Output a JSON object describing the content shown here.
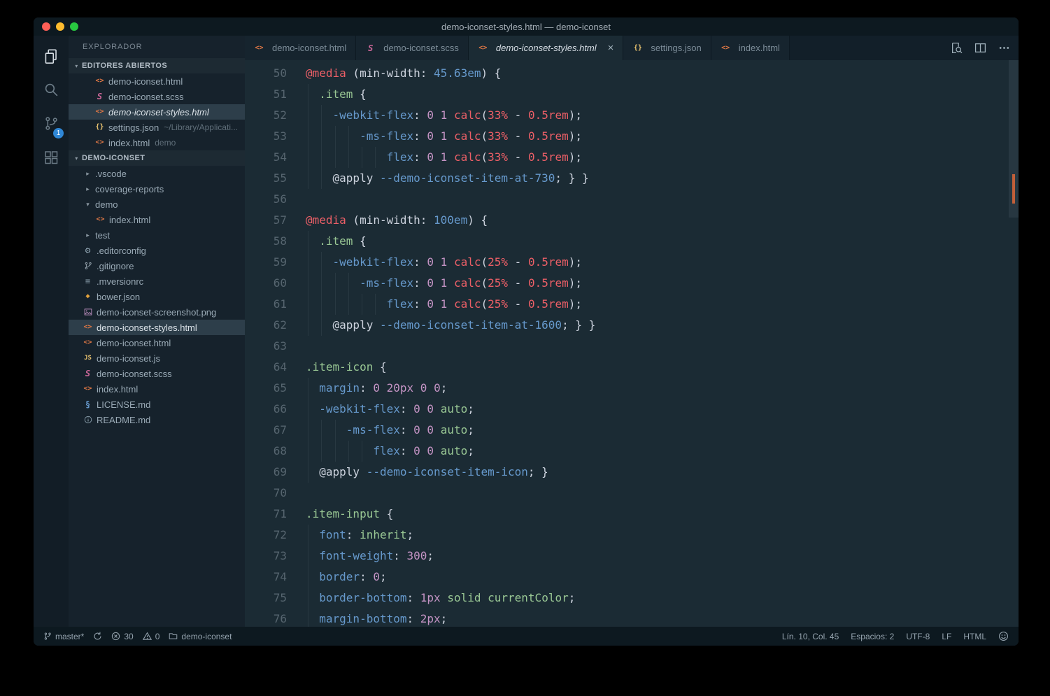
{
  "palette": {
    "editor_bg": "#1b2b34",
    "sidebar_bg": "#16222c",
    "titlebar_bg": "#0d1920",
    "activitybar_bg": "#121d26",
    "statusbar_bg": "#0d1920",
    "selection_bg": "#2d3e4a",
    "token_red": "#ec5f67",
    "token_blue": "#6699cc",
    "token_green": "#99c794",
    "token_purple": "#c594c5",
    "token_fg": "#cdd3de",
    "badge_blue": "#2f87d6",
    "overview_marker": "#c15f39"
  },
  "titlebar": {
    "title": "demo-iconset-styles.html — demo-iconset"
  },
  "activity_bar": {
    "items": [
      {
        "name": "explorer",
        "icon": "files-icon",
        "active": true
      },
      {
        "name": "search",
        "icon": "search-icon"
      },
      {
        "name": "source-control",
        "icon": "source-control-icon",
        "badge": "1"
      },
      {
        "name": "extensions",
        "icon": "extensions-icon"
      }
    ]
  },
  "sidebar": {
    "title": "EXPLORADOR",
    "sections": [
      {
        "label": "EDITORES ABIERTOS",
        "items": [
          {
            "icon": "html-icon",
            "label": "demo-iconset.html"
          },
          {
            "icon": "sass-icon",
            "label": "demo-iconset.scss"
          },
          {
            "icon": "html-icon",
            "label": "demo-iconset-styles.html",
            "active": true,
            "italic": true
          },
          {
            "icon": "json-icon",
            "label": "settings.json",
            "detail": "~/Library/Applicati..."
          },
          {
            "icon": "html-icon",
            "label": "index.html",
            "detail": "demo"
          }
        ]
      },
      {
        "label": "DEMO-ICONSET",
        "items": [
          {
            "chevron": "collapsed",
            "label": ".vscode"
          },
          {
            "chevron": "collapsed",
            "label": "coverage-reports"
          },
          {
            "chevron": "expanded",
            "label": "demo"
          },
          {
            "icon": "html-icon",
            "label": "index.html",
            "indent": 1
          },
          {
            "chevron": "collapsed",
            "label": "test"
          },
          {
            "icon": "gear-icon",
            "label": ".editorconfig"
          },
          {
            "icon": "git-icon",
            "label": ".gitignore"
          },
          {
            "icon": "list-icon",
            "label": ".mversionrc"
          },
          {
            "icon": "bower-icon",
            "label": "bower.json"
          },
          {
            "icon": "image-icon",
            "label": "demo-iconset-screenshot.png"
          },
          {
            "icon": "html-icon",
            "label": "demo-iconset-styles.html",
            "selected": true
          },
          {
            "icon": "html-icon",
            "label": "demo-iconset.html"
          },
          {
            "icon": "js-icon",
            "label": "demo-iconset.js"
          },
          {
            "icon": "sass-icon",
            "label": "demo-iconset.scss"
          },
          {
            "icon": "html-icon",
            "label": "index.html"
          },
          {
            "icon": "license-icon",
            "label": "LICENSE.md"
          },
          {
            "icon": "info-icon",
            "label": "README.md"
          }
        ]
      }
    ]
  },
  "tabs": [
    {
      "icon": "html-icon",
      "label": "demo-iconset.html"
    },
    {
      "icon": "sass-icon",
      "label": "demo-iconset.scss"
    },
    {
      "icon": "html-icon",
      "label": "demo-iconset-styles.html",
      "active": true,
      "close": "×"
    },
    {
      "icon": "json-icon",
      "label": "settings.json"
    },
    {
      "icon": "html-icon",
      "label": "index.html"
    }
  ],
  "editor_actions": [
    {
      "name": "open-preview-icon"
    },
    {
      "name": "split-editor-icon"
    },
    {
      "name": "more-actions-icon"
    }
  ],
  "editor": {
    "lines": [
      {
        "n": 50,
        "i": 0,
        "t": [
          [
            "@media",
            "r"
          ],
          [
            " (min-width: ",
            "f"
          ],
          [
            "45.63em",
            "b"
          ],
          [
            ") {",
            "f"
          ]
        ]
      },
      {
        "n": 51,
        "i": 2,
        "t": [
          [
            ".item",
            "g"
          ],
          [
            " {",
            "f"
          ]
        ]
      },
      {
        "n": 52,
        "i": 4,
        "t": [
          [
            "-webkit-flex",
            "b"
          ],
          [
            ": ",
            "f"
          ],
          [
            "0",
            "p"
          ],
          [
            " ",
            "f"
          ],
          [
            "1",
            "p"
          ],
          [
            " ",
            "f"
          ],
          [
            "calc",
            "r"
          ],
          [
            "(",
            "f"
          ],
          [
            "33%",
            "r"
          ],
          [
            " - ",
            "f"
          ],
          [
            "0.5rem",
            "r"
          ],
          [
            ");",
            "f"
          ]
        ]
      },
      {
        "n": 53,
        "i": 8,
        "t": [
          [
            "-ms-flex",
            "b"
          ],
          [
            ": ",
            "f"
          ],
          [
            "0",
            "p"
          ],
          [
            " ",
            "f"
          ],
          [
            "1",
            "p"
          ],
          [
            " ",
            "f"
          ],
          [
            "calc",
            "r"
          ],
          [
            "(",
            "f"
          ],
          [
            "33%",
            "r"
          ],
          [
            " - ",
            "f"
          ],
          [
            "0.5rem",
            "r"
          ],
          [
            ");",
            "f"
          ]
        ]
      },
      {
        "n": 54,
        "i": 12,
        "t": [
          [
            "flex",
            "b"
          ],
          [
            ": ",
            "f"
          ],
          [
            "0",
            "p"
          ],
          [
            " ",
            "f"
          ],
          [
            "1",
            "p"
          ],
          [
            " ",
            "f"
          ],
          [
            "calc",
            "r"
          ],
          [
            "(",
            "f"
          ],
          [
            "33%",
            "r"
          ],
          [
            " - ",
            "f"
          ],
          [
            "0.5rem",
            "r"
          ],
          [
            ");",
            "f"
          ]
        ]
      },
      {
        "n": 55,
        "i": 4,
        "t": [
          [
            "@apply ",
            "f"
          ],
          [
            "--demo-iconset-item-at-730",
            "b"
          ],
          [
            "; } }",
            "f"
          ]
        ]
      },
      {
        "n": 56,
        "i": 0,
        "t": []
      },
      {
        "n": 57,
        "i": 0,
        "t": [
          [
            "@media",
            "r"
          ],
          [
            " (min-width: ",
            "f"
          ],
          [
            "100em",
            "b"
          ],
          [
            ") {",
            "f"
          ]
        ]
      },
      {
        "n": 58,
        "i": 2,
        "t": [
          [
            ".item",
            "g"
          ],
          [
            " {",
            "f"
          ]
        ]
      },
      {
        "n": 59,
        "i": 4,
        "t": [
          [
            "-webkit-flex",
            "b"
          ],
          [
            ": ",
            "f"
          ],
          [
            "0",
            "p"
          ],
          [
            " ",
            "f"
          ],
          [
            "1",
            "p"
          ],
          [
            " ",
            "f"
          ],
          [
            "calc",
            "r"
          ],
          [
            "(",
            "f"
          ],
          [
            "25%",
            "r"
          ],
          [
            " - ",
            "f"
          ],
          [
            "0.5rem",
            "r"
          ],
          [
            ");",
            "f"
          ]
        ]
      },
      {
        "n": 60,
        "i": 8,
        "t": [
          [
            "-ms-flex",
            "b"
          ],
          [
            ": ",
            "f"
          ],
          [
            "0",
            "p"
          ],
          [
            " ",
            "f"
          ],
          [
            "1",
            "p"
          ],
          [
            " ",
            "f"
          ],
          [
            "calc",
            "r"
          ],
          [
            "(",
            "f"
          ],
          [
            "25%",
            "r"
          ],
          [
            " - ",
            "f"
          ],
          [
            "0.5rem",
            "r"
          ],
          [
            ");",
            "f"
          ]
        ]
      },
      {
        "n": 61,
        "i": 12,
        "t": [
          [
            "flex",
            "b"
          ],
          [
            ": ",
            "f"
          ],
          [
            "0",
            "p"
          ],
          [
            " ",
            "f"
          ],
          [
            "1",
            "p"
          ],
          [
            " ",
            "f"
          ],
          [
            "calc",
            "r"
          ],
          [
            "(",
            "f"
          ],
          [
            "25%",
            "r"
          ],
          [
            " - ",
            "f"
          ],
          [
            "0.5rem",
            "r"
          ],
          [
            ");",
            "f"
          ]
        ]
      },
      {
        "n": 62,
        "i": 4,
        "t": [
          [
            "@apply ",
            "f"
          ],
          [
            "--demo-iconset-item-at-1600",
            "b"
          ],
          [
            "; } }",
            "f"
          ]
        ]
      },
      {
        "n": 63,
        "i": 0,
        "t": []
      },
      {
        "n": 64,
        "i": 0,
        "t": [
          [
            ".item-icon",
            "g"
          ],
          [
            " {",
            "f"
          ]
        ]
      },
      {
        "n": 65,
        "i": 2,
        "t": [
          [
            "margin",
            "b"
          ],
          [
            ": ",
            "f"
          ],
          [
            "0",
            "p"
          ],
          [
            " ",
            "f"
          ],
          [
            "20px",
            "p"
          ],
          [
            " ",
            "f"
          ],
          [
            "0",
            "p"
          ],
          [
            " ",
            "f"
          ],
          [
            "0",
            "p"
          ],
          [
            ";",
            "f"
          ]
        ]
      },
      {
        "n": 66,
        "i": 2,
        "t": [
          [
            "-webkit-flex",
            "b"
          ],
          [
            ": ",
            "f"
          ],
          [
            "0",
            "p"
          ],
          [
            " ",
            "f"
          ],
          [
            "0",
            "p"
          ],
          [
            " ",
            "f"
          ],
          [
            "auto",
            "g"
          ],
          [
            ";",
            "f"
          ]
        ]
      },
      {
        "n": 67,
        "i": 6,
        "t": [
          [
            "-ms-flex",
            "b"
          ],
          [
            ": ",
            "f"
          ],
          [
            "0",
            "p"
          ],
          [
            " ",
            "f"
          ],
          [
            "0",
            "p"
          ],
          [
            " ",
            "f"
          ],
          [
            "auto",
            "g"
          ],
          [
            ";",
            "f"
          ]
        ]
      },
      {
        "n": 68,
        "i": 10,
        "t": [
          [
            "flex",
            "b"
          ],
          [
            ": ",
            "f"
          ],
          [
            "0",
            "p"
          ],
          [
            " ",
            "f"
          ],
          [
            "0",
            "p"
          ],
          [
            " ",
            "f"
          ],
          [
            "auto",
            "g"
          ],
          [
            ";",
            "f"
          ]
        ]
      },
      {
        "n": 69,
        "i": 2,
        "t": [
          [
            "@apply ",
            "f"
          ],
          [
            "--demo-iconset-item-icon",
            "b"
          ],
          [
            "; }",
            "f"
          ]
        ]
      },
      {
        "n": 70,
        "i": 0,
        "t": []
      },
      {
        "n": 71,
        "i": 0,
        "t": [
          [
            ".item-input",
            "g"
          ],
          [
            " {",
            "f"
          ]
        ]
      },
      {
        "n": 72,
        "i": 2,
        "t": [
          [
            "font",
            "b"
          ],
          [
            ": ",
            "f"
          ],
          [
            "inherit",
            "g"
          ],
          [
            ";",
            "f"
          ]
        ]
      },
      {
        "n": 73,
        "i": 2,
        "t": [
          [
            "font-weight",
            "b"
          ],
          [
            ": ",
            "f"
          ],
          [
            "300",
            "p"
          ],
          [
            ";",
            "f"
          ]
        ]
      },
      {
        "n": 74,
        "i": 2,
        "t": [
          [
            "border",
            "b"
          ],
          [
            ": ",
            "f"
          ],
          [
            "0",
            "p"
          ],
          [
            ";",
            "f"
          ]
        ]
      },
      {
        "n": 75,
        "i": 2,
        "t": [
          [
            "border-bottom",
            "b"
          ],
          [
            ": ",
            "f"
          ],
          [
            "1px",
            "p"
          ],
          [
            " ",
            "f"
          ],
          [
            "solid",
            "g"
          ],
          [
            " ",
            "f"
          ],
          [
            "currentColor",
            "g"
          ],
          [
            ";",
            "f"
          ]
        ]
      },
      {
        "n": 76,
        "i": 2,
        "t": [
          [
            "margin-bottom",
            "b"
          ],
          [
            ": ",
            "f"
          ],
          [
            "2px",
            "p"
          ],
          [
            ";",
            "f"
          ]
        ]
      }
    ]
  },
  "status_bar": {
    "left": [
      {
        "name": "status-branch",
        "icon": "branch-icon",
        "label": "master*"
      },
      {
        "name": "status-sync",
        "icon": "sync-icon",
        "label": ""
      },
      {
        "name": "status-errors",
        "icon": "error-icon",
        "label": "30"
      },
      {
        "name": "status-warnings",
        "icon": "warning-icon",
        "label": "0"
      },
      {
        "name": "status-folder",
        "icon": "folder-icon",
        "label": "demo-iconset"
      }
    ],
    "right": [
      {
        "name": "status-cursor-position",
        "label": "Lín. 10, Col. 45"
      },
      {
        "name": "status-indentation",
        "label": "Espacios: 2"
      },
      {
        "name": "status-encoding",
        "label": "UTF-8"
      },
      {
        "name": "status-eol",
        "label": "LF"
      },
      {
        "name": "status-language",
        "label": "HTML"
      },
      {
        "name": "status-feedback",
        "icon": "smiley-icon",
        "label": ""
      }
    ]
  }
}
